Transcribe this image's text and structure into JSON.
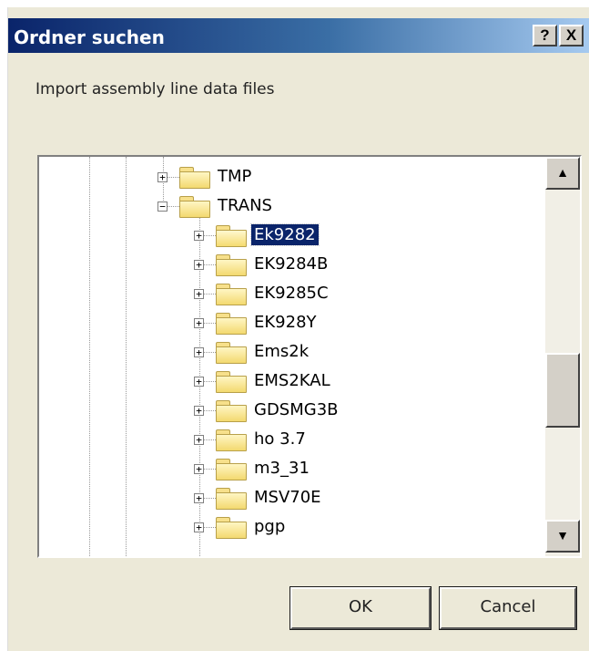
{
  "window": {
    "title": "Ordner suchen",
    "help_label": "?",
    "close_label": "X"
  },
  "description": "Import assembly line data files",
  "tree": {
    "items": [
      {
        "label": "TMP",
        "expander": "+",
        "level": 0,
        "selected": false,
        "open": false
      },
      {
        "label": "TRANS",
        "expander": "−",
        "level": 0,
        "selected": false,
        "open": false
      },
      {
        "label": "Ek9282",
        "expander": "+",
        "level": 1,
        "selected": true,
        "open": true
      },
      {
        "label": "EK9284B",
        "expander": "+",
        "level": 1,
        "selected": false,
        "open": false
      },
      {
        "label": "EK9285C",
        "expander": "+",
        "level": 1,
        "selected": false,
        "open": false
      },
      {
        "label": "EK928Y",
        "expander": "+",
        "level": 1,
        "selected": false,
        "open": false
      },
      {
        "label": "Ems2k",
        "expander": "+",
        "level": 1,
        "selected": false,
        "open": false
      },
      {
        "label": "EMS2KAL",
        "expander": "+",
        "level": 1,
        "selected": false,
        "open": false
      },
      {
        "label": "GDSMG3B",
        "expander": "+",
        "level": 1,
        "selected": false,
        "open": false
      },
      {
        "label": "ho 3.7",
        "expander": "+",
        "level": 1,
        "selected": false,
        "open": false
      },
      {
        "label": "m3_31",
        "expander": "+",
        "level": 1,
        "selected": false,
        "open": false
      },
      {
        "label": "MSV70E",
        "expander": "+",
        "level": 1,
        "selected": false,
        "open": false
      },
      {
        "label": "pgp",
        "expander": "+",
        "level": 1,
        "selected": false,
        "open": false
      }
    ]
  },
  "scrollbar": {
    "up_arrow": "▲",
    "down_arrow": "▼"
  },
  "buttons": {
    "ok_label": "OK",
    "cancel_label": "Cancel"
  }
}
